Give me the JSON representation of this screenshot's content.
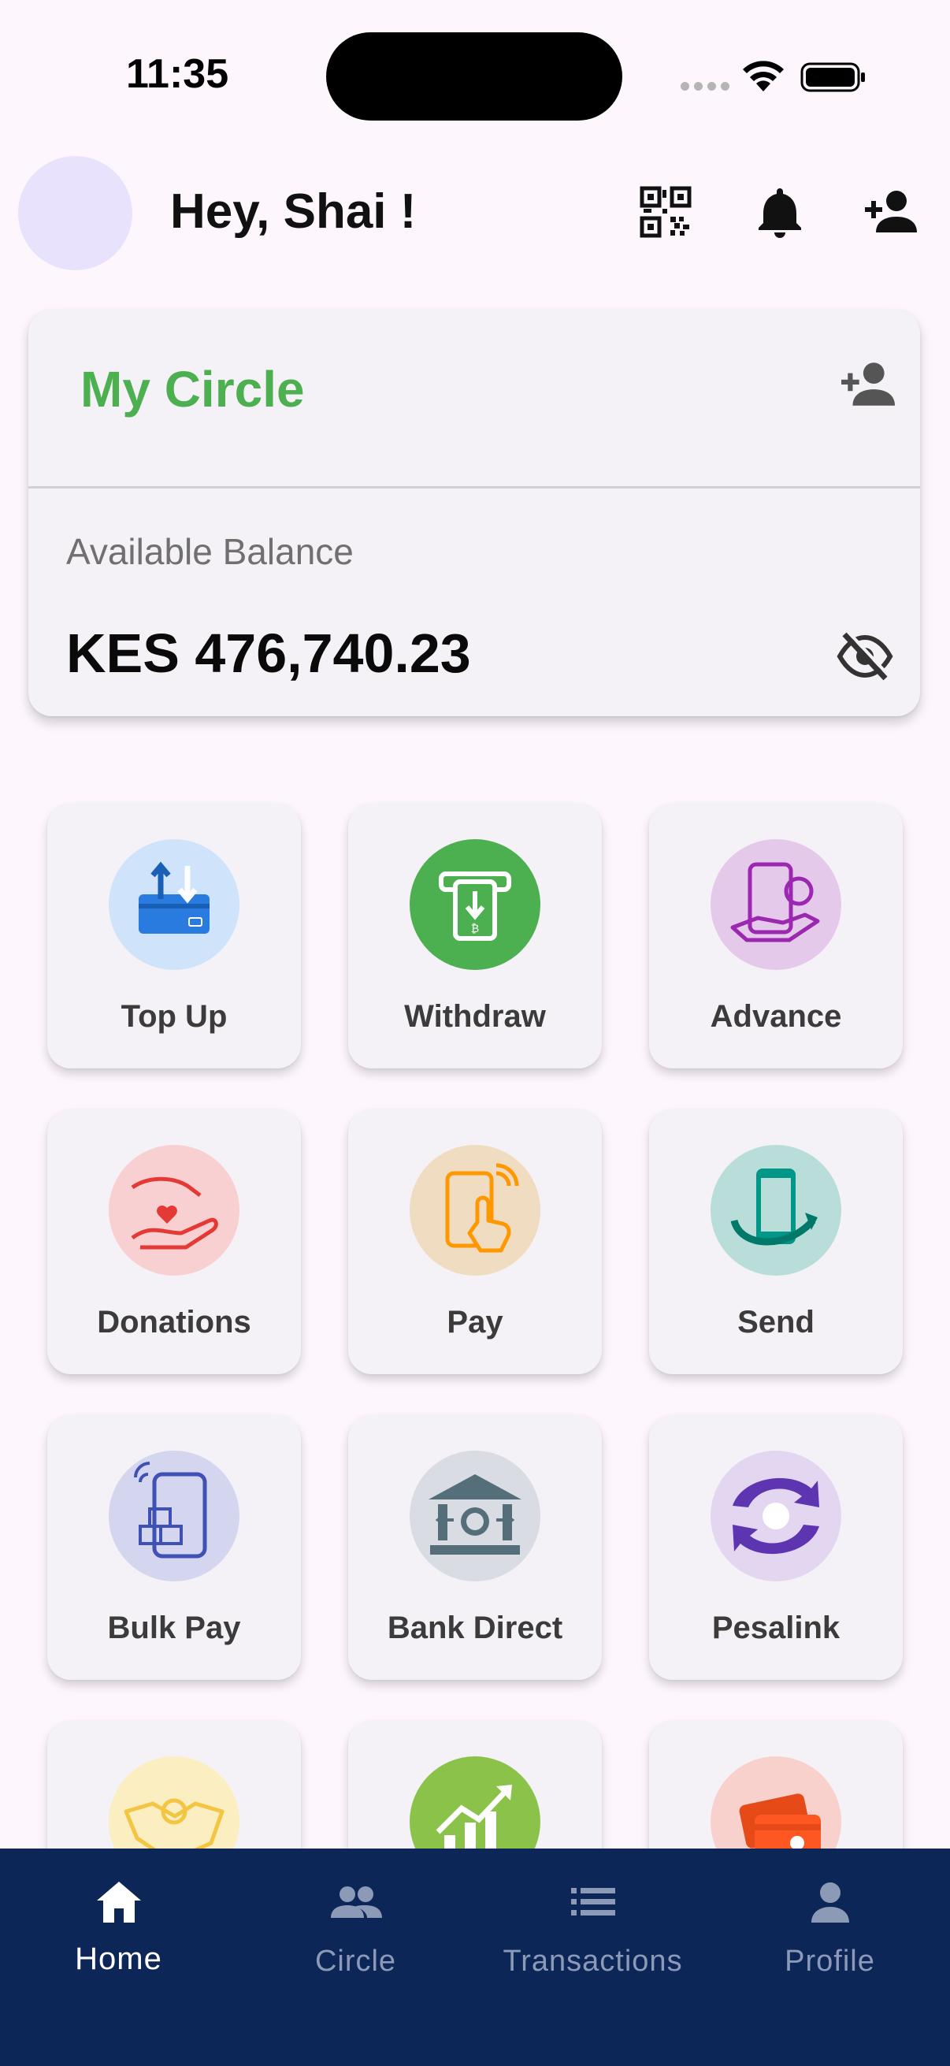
{
  "status_bar": {
    "time": "11:35"
  },
  "header": {
    "greeting": "Hey, Shai !",
    "icons": [
      "qr-code-icon",
      "bell-icon",
      "add-user-icon"
    ]
  },
  "circle_card": {
    "title": "My Circle",
    "balance_label": "Available Balance",
    "balance_value": "KES 476,740.23",
    "title_color": "#4caf50"
  },
  "actions": [
    {
      "label": "Top Up",
      "icon": "top-up-icon",
      "bg": "#cfe3fb"
    },
    {
      "label": "Withdraw",
      "icon": "withdraw-icon",
      "bg": "#4caf50"
    },
    {
      "label": "Advance",
      "icon": "advance-icon",
      "bg": "#e5c9ea"
    },
    {
      "label": "Donations",
      "icon": "donations-icon",
      "bg": "#f8d0d2"
    },
    {
      "label": "Pay",
      "icon": "pay-icon",
      "bg": "#f0dcc0"
    },
    {
      "label": "Send",
      "icon": "send-icon",
      "bg": "#b9ddd8"
    },
    {
      "label": "Bulk Pay",
      "icon": "bulk-pay-icon",
      "bg": "#d4d5ee"
    },
    {
      "label": "Bank Direct",
      "icon": "bank-direct-icon",
      "bg": "#d9dce2"
    },
    {
      "label": "Pesalink",
      "icon": "pesalink-icon",
      "bg": "#e3d6f1"
    },
    {
      "label": "",
      "icon": "handshake-icon",
      "bg": "#fbeec0"
    },
    {
      "label": "",
      "icon": "growth-chart-icon",
      "bg": "#8bc34a"
    },
    {
      "label": "",
      "icon": "card-icon",
      "bg": "#f8d0cc"
    }
  ],
  "bottom_nav": [
    {
      "label": "Home",
      "icon": "home-icon",
      "active": true
    },
    {
      "label": "Circle",
      "icon": "people-icon",
      "active": false
    },
    {
      "label": "Transactions",
      "icon": "list-icon",
      "active": false
    },
    {
      "label": "Profile",
      "icon": "person-icon",
      "active": false
    }
  ],
  "colors": {
    "nav_bg": "#0d2658",
    "page_bg": "#fdf7fd",
    "accent_green": "#4caf50"
  }
}
